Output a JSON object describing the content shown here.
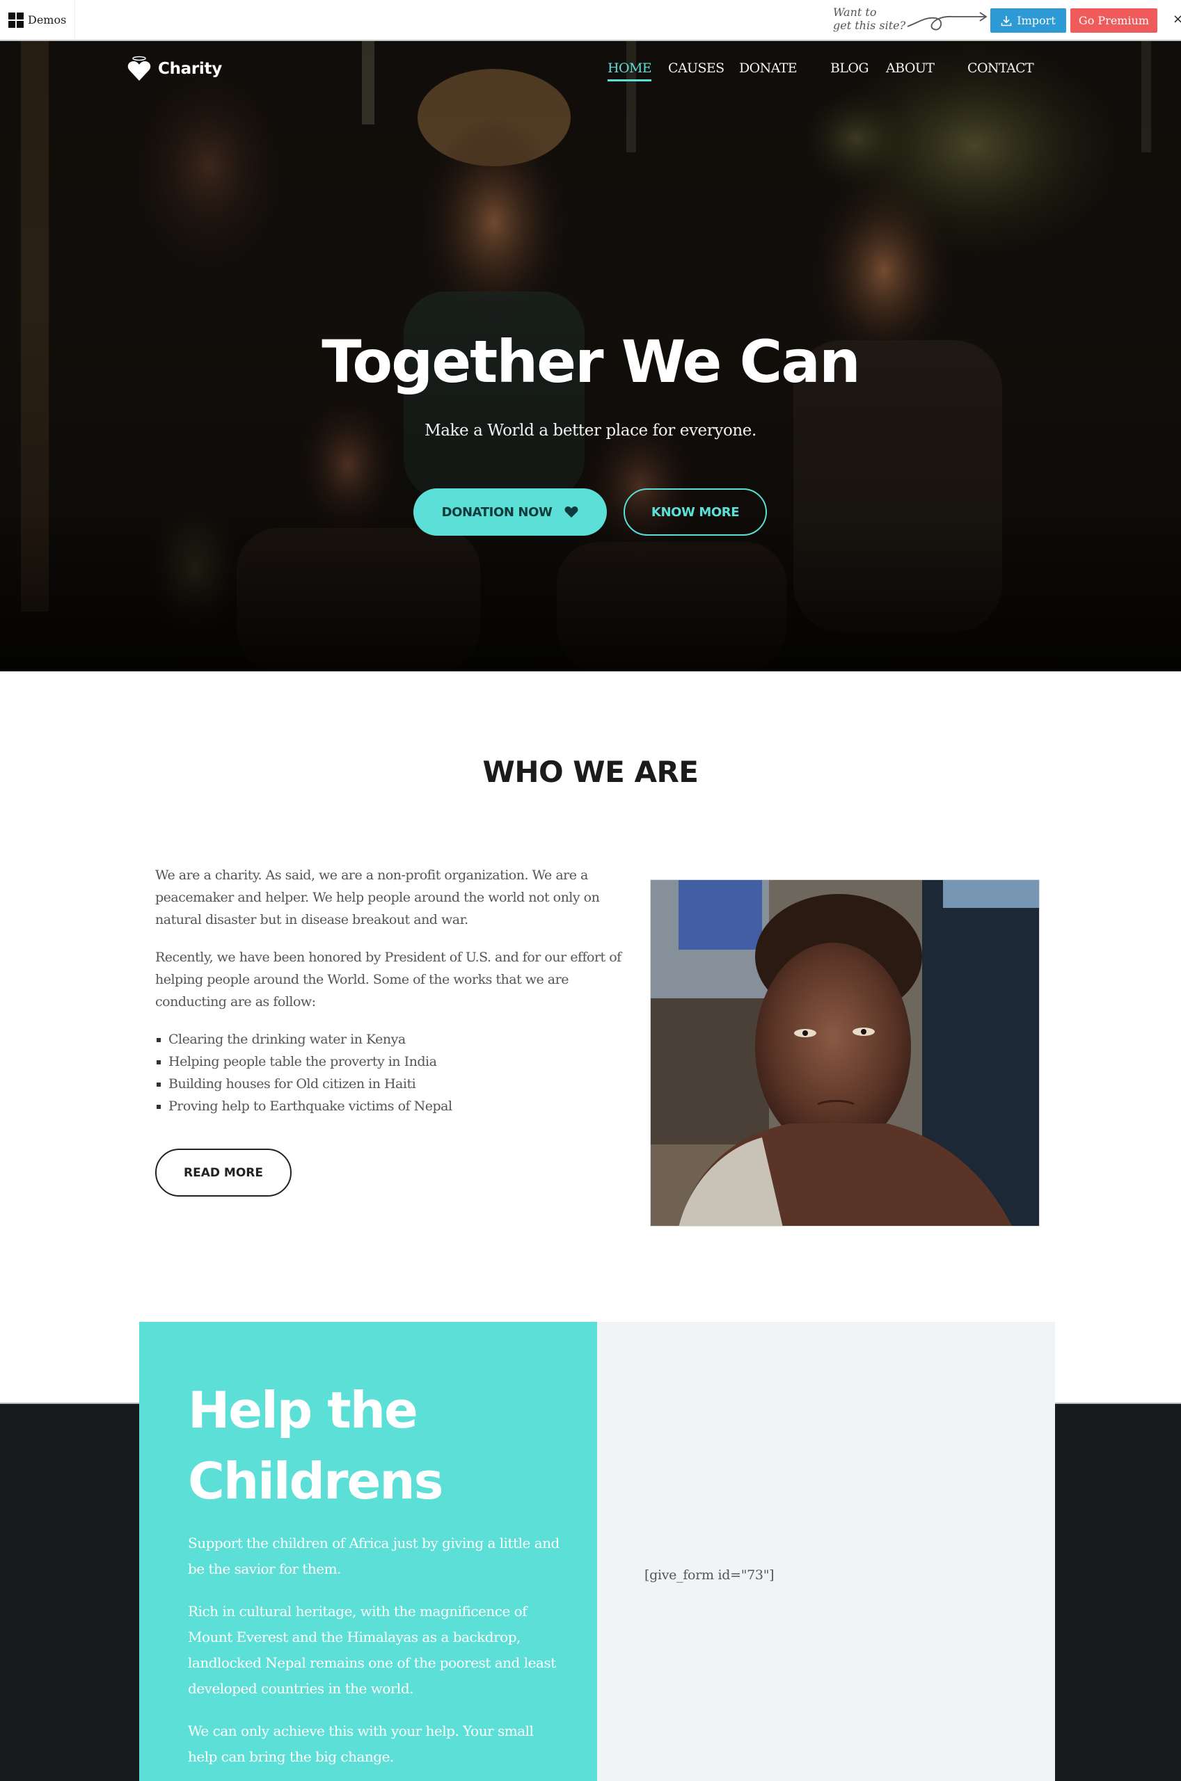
{
  "demobar": {
    "demos_label": "Demos",
    "want_line1": "Want to",
    "want_line2": "get this site?",
    "import_label": "Import",
    "premium_label": "Go Premium",
    "close_label": "×",
    "colors": {
      "import": "#2d9ad5",
      "premium": "#ef5b5b"
    }
  },
  "header": {
    "logo_text": "Charity",
    "nav": [
      {
        "label": "HOME",
        "active": true
      },
      {
        "label": "CAUSES",
        "active": false
      },
      {
        "label": "DONATE",
        "active": false
      },
      {
        "label": "BLOG",
        "active": false
      },
      {
        "label": "ABOUT",
        "active": false
      },
      {
        "label": "CONTACT",
        "active": false
      }
    ],
    "search_icon": "search-icon"
  },
  "hero": {
    "title": "Together We Can",
    "subtitle": "Make a World a better place for everyone.",
    "primary_button": "DONATION NOW",
    "primary_icon": "heart-icon",
    "secondary_button": "KNOW MORE",
    "accent_color": "#5cdfd6"
  },
  "who": {
    "title": "WHO WE ARE",
    "paragraphs": [
      "We are a charity. As said, we are a non-profit organization. We are a peacemaker and helper. We help people around the world not only on natural disaster but in disease breakout and war.",
      "Recently, we have been honored by President of U.S. and for our effort of helping people around the World. Some of the works that we are conducting are as follow:"
    ],
    "list": [
      "Clearing the drinking water in Kenya",
      "Helping people table the proverty in India",
      "Building houses for Old citizen in Haiti",
      "Proving help to Earthquake victims of Nepal"
    ],
    "button": "READ MORE"
  },
  "help": {
    "title_line1": "Help the",
    "title_line2": "Childrens",
    "paragraphs": [
      "Support the children of Africa just by giving a little and be the savior for them.",
      "Rich in cultural heritage, with the magnificence of Mount Everest and the Himalayas as a backdrop, landlocked Nepal remains one of the poorest and least developed countries in the world.",
      "We can only achieve this with your help. Your small help can bring the big change."
    ],
    "form_shortcode": "[give_form id=\"73\"]"
  }
}
